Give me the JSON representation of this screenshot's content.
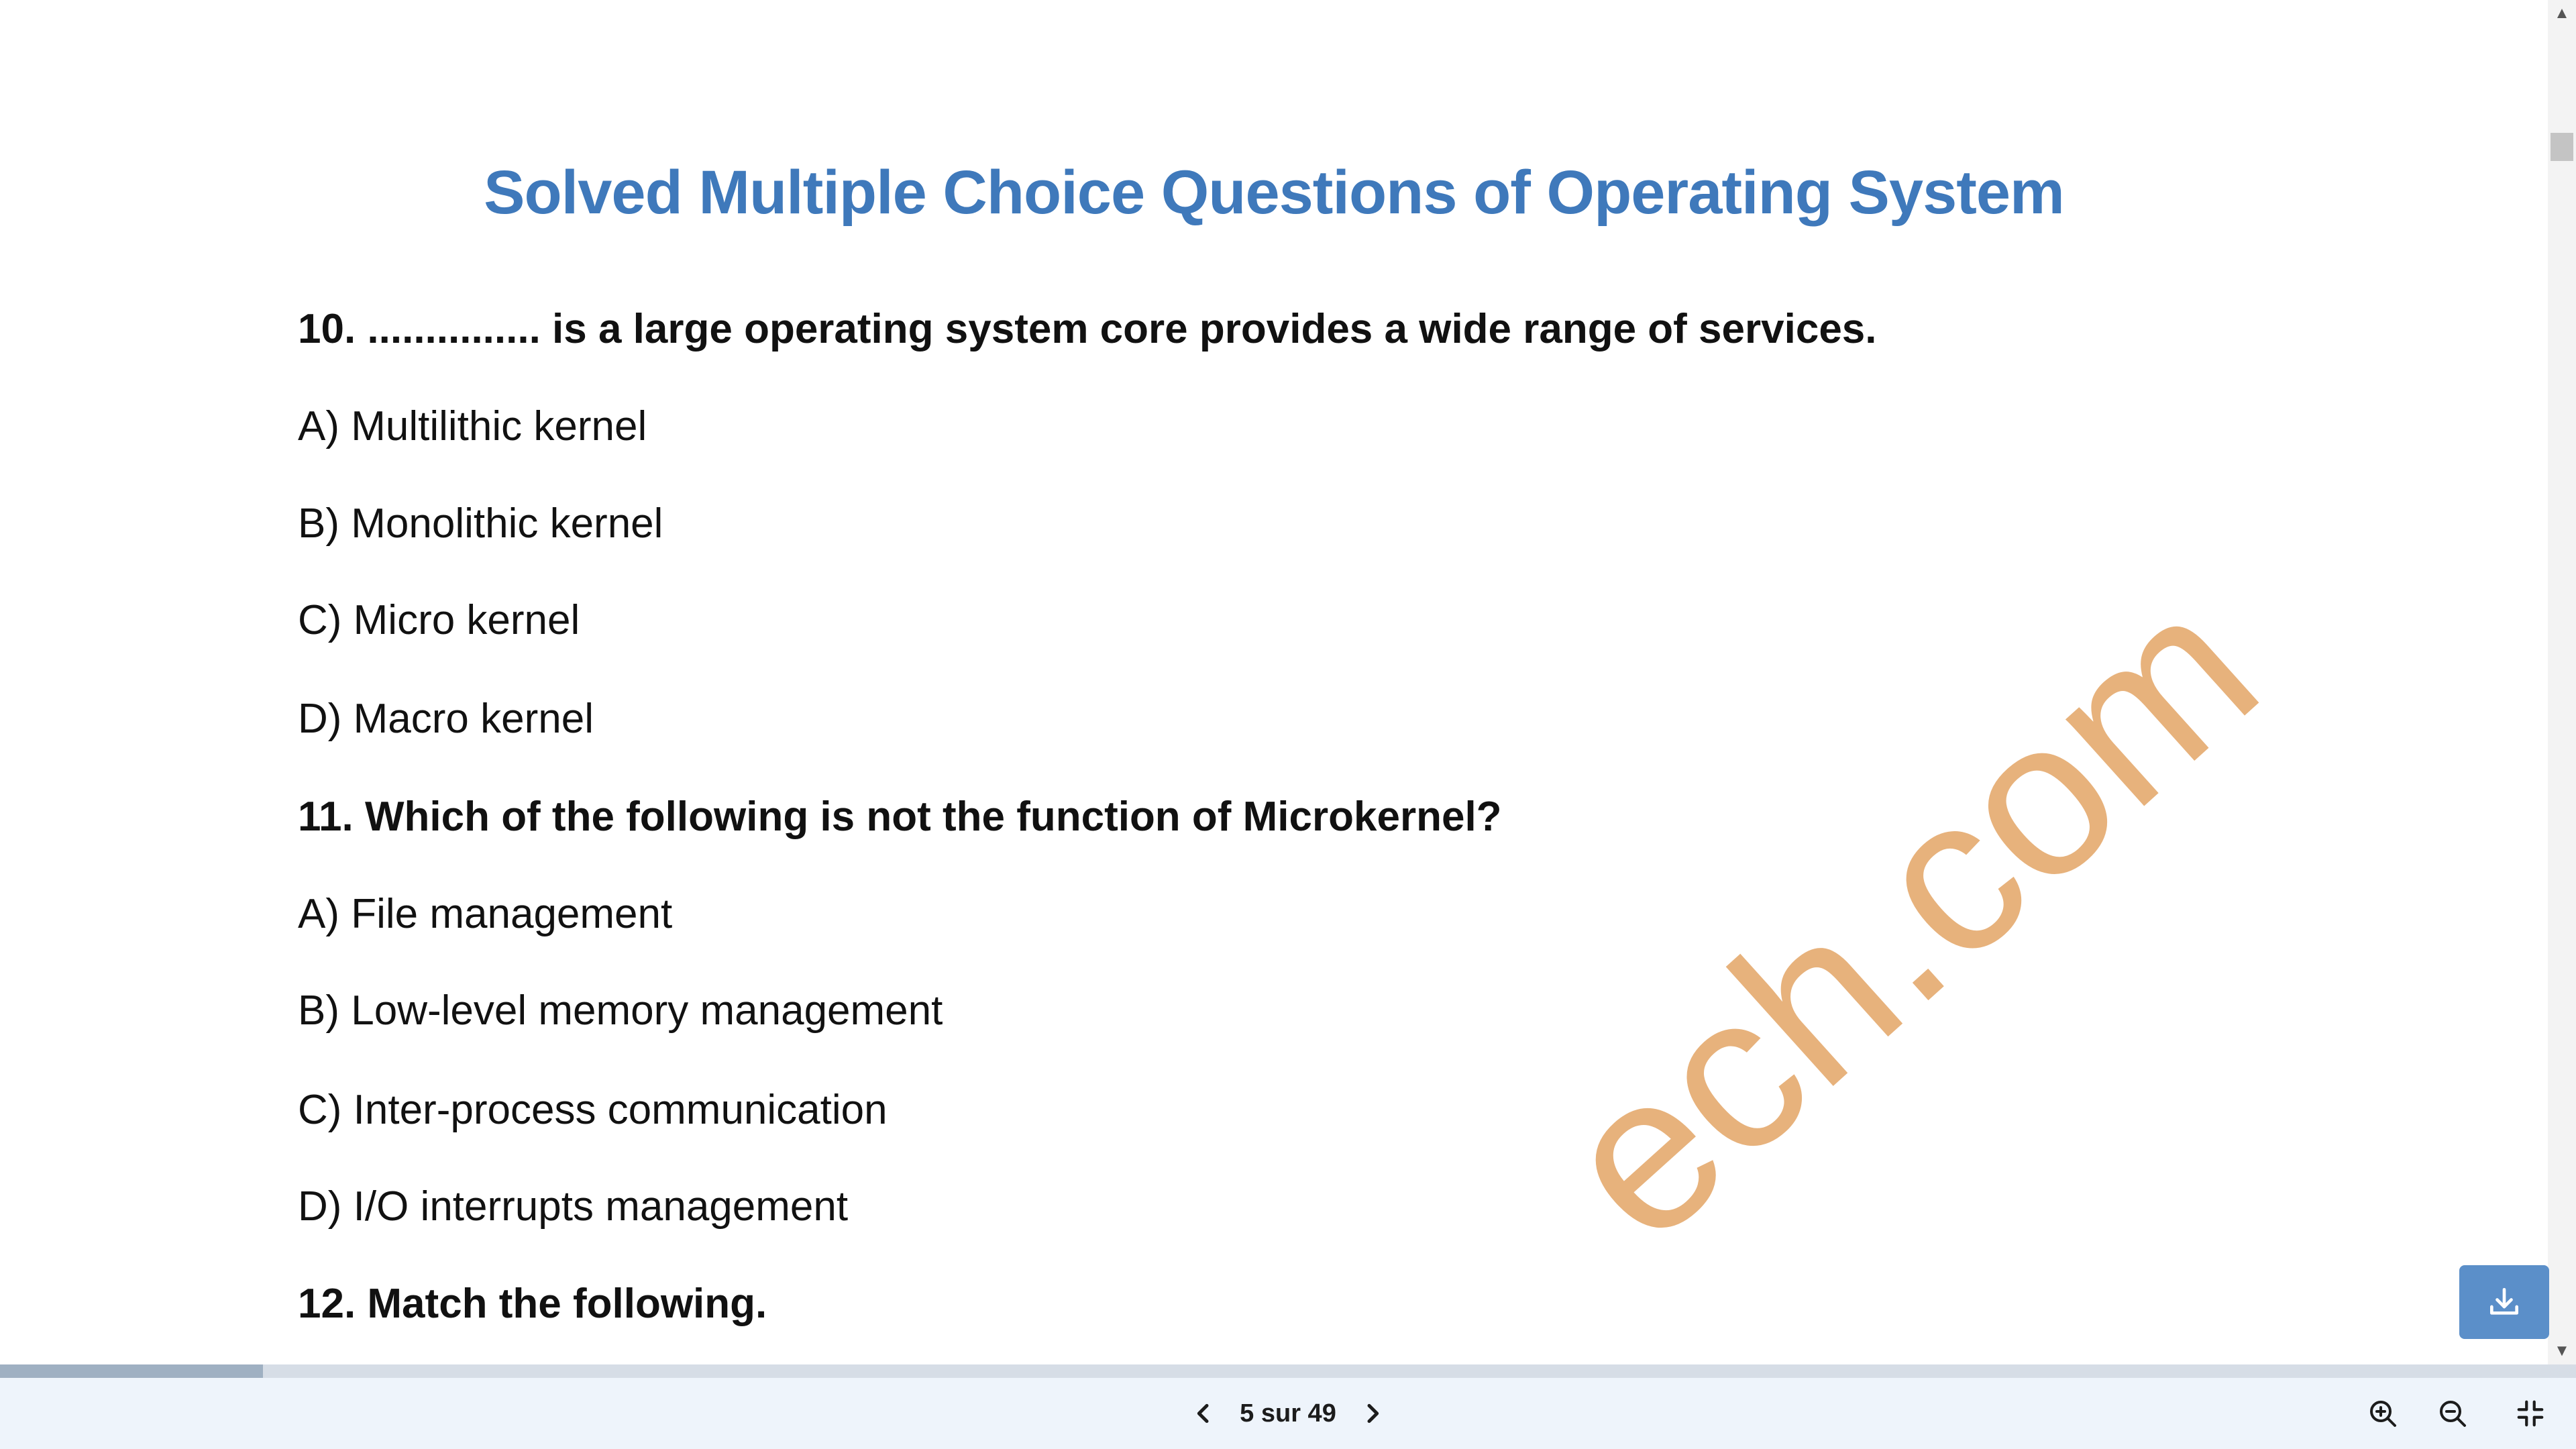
{
  "document": {
    "title": "Solved Multiple Choice Questions of Operating System",
    "lines": [
      {
        "kind": "question",
        "text": "10. ............... is a large operating system core provides a wide range of services."
      },
      {
        "kind": "option",
        "text": "A) Multilithic kernel"
      },
      {
        "kind": "option",
        "text": "B) Monolithic kernel"
      },
      {
        "kind": "option",
        "text": "C) Micro kernel"
      },
      {
        "kind": "option",
        "text": "D) Macro kernel"
      },
      {
        "kind": "question",
        "text": "11. Which of the following is not the function of Microkernel?"
      },
      {
        "kind": "option",
        "text": "A) File management"
      },
      {
        "kind": "option",
        "text": "B) Low-level memory management"
      },
      {
        "kind": "option",
        "text": "C) Inter-process communication"
      },
      {
        "kind": "option",
        "text": "D) I/O interrupts management"
      },
      {
        "kind": "question",
        "text": "12. Match the following."
      }
    ],
    "watermark": "ech.com"
  },
  "viewer": {
    "page_indicator": "5 sur 49",
    "current_page": 5,
    "total_pages": 49,
    "progress_fraction": 0.102
  },
  "icons": {
    "prev": "chevron-left-icon",
    "next": "chevron-right-icon",
    "zoom_in": "zoom-in-icon",
    "zoom_out": "zoom-out-icon",
    "exit_fullscreen": "exit-fullscreen-icon",
    "download": "download-icon"
  },
  "colors": {
    "title": "#3f79bb",
    "watermark": "#e7b27c",
    "download_button": "#5b8fc9",
    "toolbar": "#eef4fb"
  }
}
